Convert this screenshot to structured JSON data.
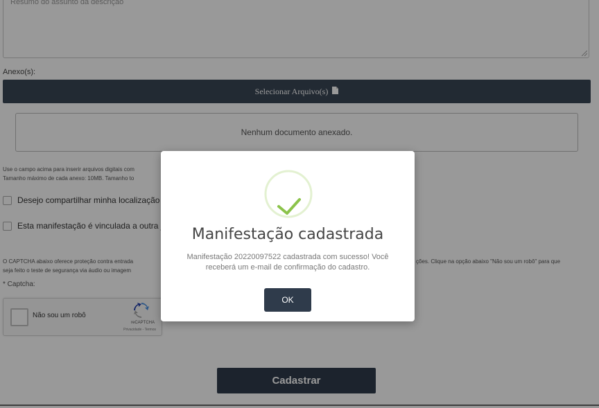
{
  "form": {
    "textarea_placeholder": "Resumo do assunto da descrição",
    "attachments_label": "Anexo(s):",
    "select_files_label": "Selecionar Arquivo(s)",
    "no_documents_text": "Nenhum documento anexado.",
    "help_line_1": "Use o campo acima para inserir arquivos digitais com",
    "help_line_2": "Tamanho máximo de cada anexo: 10MB. Tamanho to",
    "share_location_label": "Desejo compartilhar minha localização",
    "linked_manifestation_label": "Esta manifestação é vinculada a outra já",
    "captcha_info_line_1": "O CAPTCHA abaixo oferece proteção contra entrada",
    "captcha_info_line_1_right": "ções. Clique na opção abaixo \"Não sou um robô\" para que",
    "captcha_info_line_2": "seja feito o teste de segurança via áudio ou imagem",
    "captcha_label": "* Captcha:",
    "submit_label": "Cadastrar"
  },
  "recaptcha": {
    "checkbox_label": "Não sou um robô",
    "brand": "reCAPTCHA",
    "terms": "Privacidade - Termos"
  },
  "modal": {
    "title": "Manifestação cadastrada",
    "message": "Manifestação 20220097522 cadastrada com sucesso! Você receberá um e-mail de confirmação do cadastro.",
    "ok_label": "OK"
  },
  "colors": {
    "dark_button": "#2f3b4b",
    "success_green": "#8bc34a",
    "overlay": "rgba(0,0,0,0.4)"
  },
  "icons": {
    "select_files": "document-icon",
    "success": "checkmark-circle-icon",
    "recaptcha": "recaptcha-logo-icon"
  }
}
